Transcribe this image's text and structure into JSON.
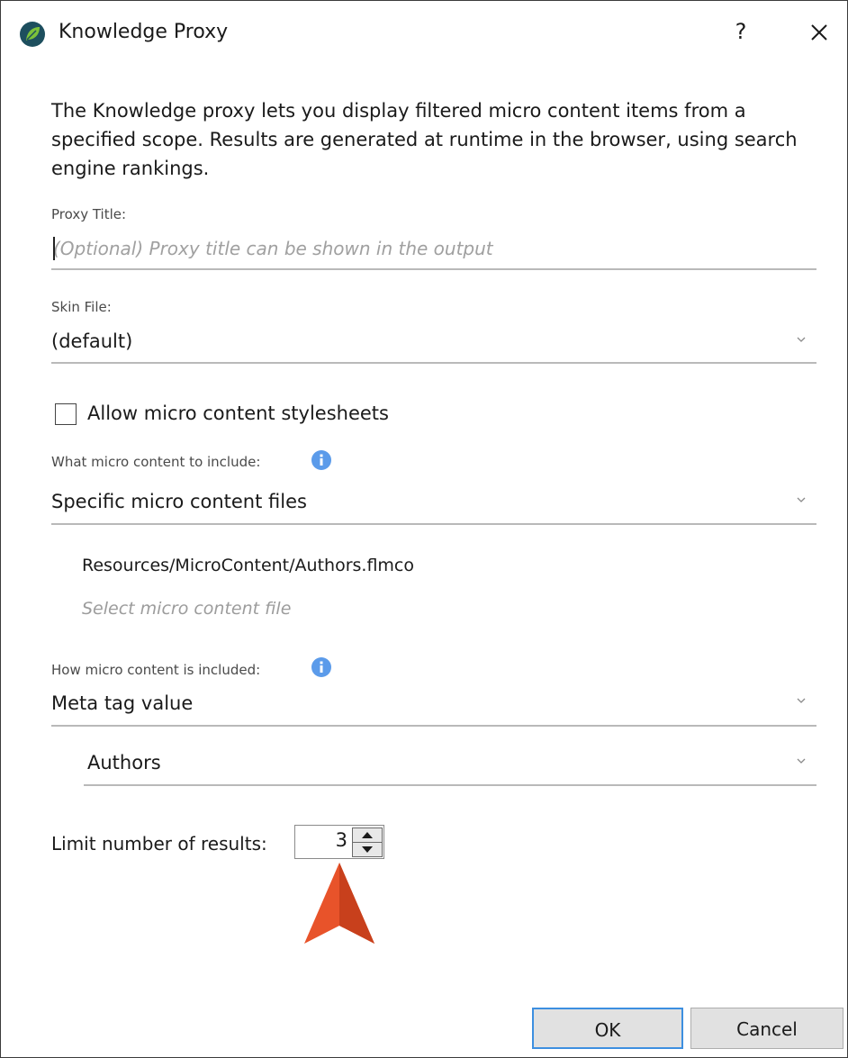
{
  "window": {
    "title": "Knowledge Proxy",
    "help_label": "?",
    "close_icon": "close-icon",
    "app_icon": "leaf-icon"
  },
  "description": "The Knowledge proxy lets you display filtered micro content items from a specified scope. Results are generated at runtime in the browser, using search engine rankings.",
  "proxy_title": {
    "label": "Proxy Title:",
    "value": "",
    "placeholder": "(Optional) Proxy title can be shown in the output"
  },
  "skin_file": {
    "label": "Skin File:",
    "value": "(default)"
  },
  "allow_stylesheets": {
    "label": "Allow micro content stylesheets",
    "checked": false
  },
  "what_to_include": {
    "label": "What micro content to include:",
    "value": "Specific micro content files",
    "files": [
      "Resources/MicroContent/Authors.flmco"
    ],
    "select_file_label": "Select micro content file"
  },
  "how_included": {
    "label": "How micro content is included:",
    "value": "Meta tag value",
    "meta_tag": "Authors"
  },
  "limit": {
    "label": "Limit number of results:",
    "value": "3"
  },
  "buttons": {
    "ok": "OK",
    "cancel": "Cancel"
  },
  "colors": {
    "accent_border": "#3d8fe0",
    "info_icon": "#5b9bea",
    "annotation_arrow": "#e8532a",
    "app_icon_green": "#6aa82a"
  }
}
